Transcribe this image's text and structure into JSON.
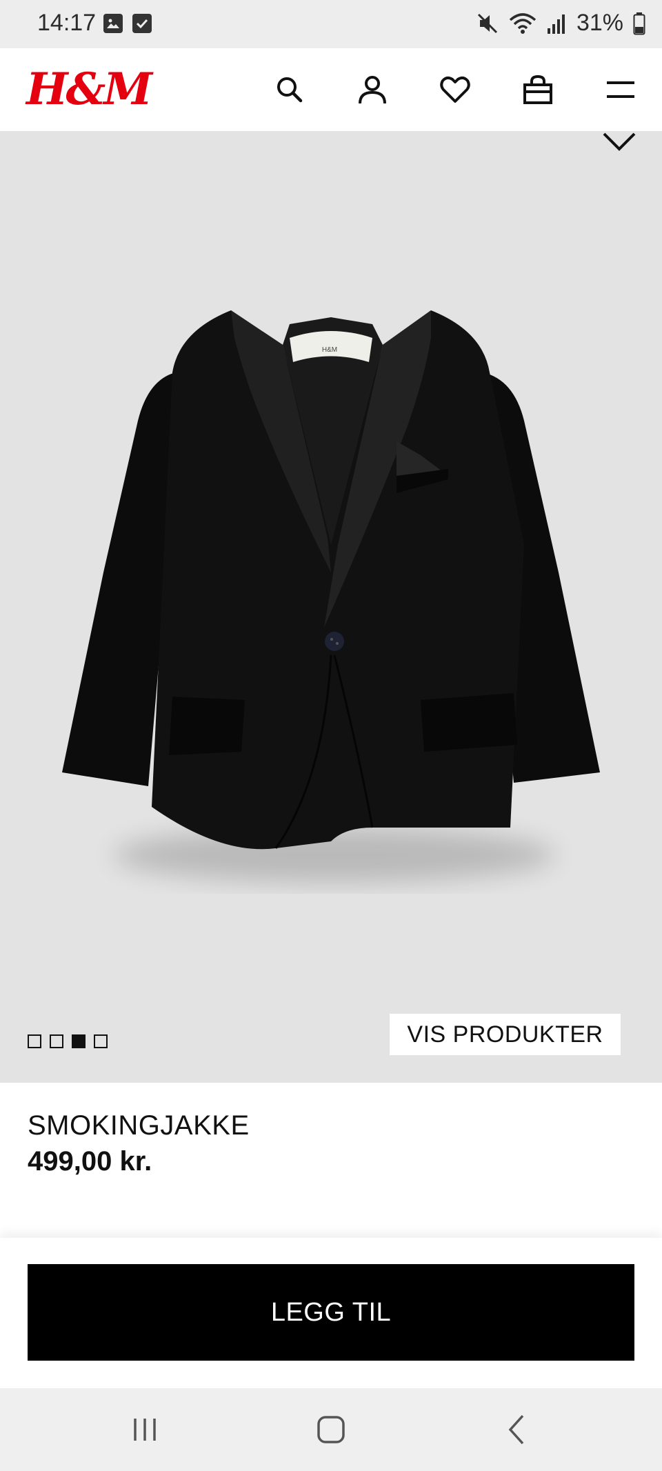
{
  "status_bar": {
    "time": "14:17",
    "battery": "31%",
    "icons": [
      "gallery-icon",
      "checkbox-icon",
      "mute-icon",
      "wifi-icon",
      "signal-icon",
      "battery-icon"
    ]
  },
  "header": {
    "logo": "H&M",
    "brand_color": "#e50010",
    "icons": [
      "search-icon",
      "account-icon",
      "heart-icon",
      "bag-icon",
      "menu-icon"
    ]
  },
  "gallery": {
    "background": "#e3e3e4",
    "pages": [
      {
        "active": false
      },
      {
        "active": false
      },
      {
        "active": true
      },
      {
        "active": false
      }
    ],
    "vis_produkter_label": "VIS PRODUKTER"
  },
  "product": {
    "name": "SMOKINGJAKKE",
    "price": "499,00 kr."
  },
  "cta": {
    "label": "LEGG TIL"
  },
  "nav": {
    "icons": [
      "recents-icon",
      "home-icon",
      "back-icon"
    ]
  }
}
